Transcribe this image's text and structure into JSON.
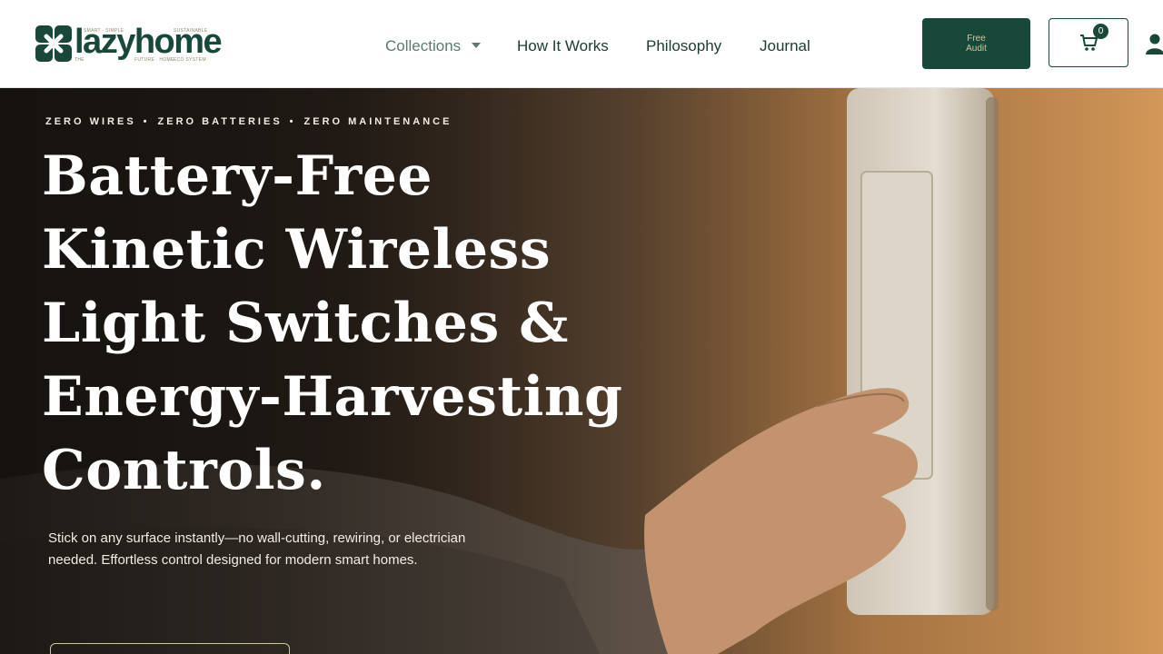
{
  "brand": {
    "name": "lazyhome",
    "tagline_top": "SMART · SIMPLE",
    "tagline_top_right": "SUSTAINABLE",
    "tagline_bottom_left": "THE",
    "tagline_bottom": "FUTURE · HOME",
    "tagline_bottom_right": "ECO SYSTEM"
  },
  "nav": {
    "items": [
      {
        "label": "Collections",
        "has_dropdown": true
      },
      {
        "label": "How It Works"
      },
      {
        "label": "Philosophy"
      },
      {
        "label": "Journal"
      }
    ]
  },
  "header_actions": {
    "audit_label": "Free Audit",
    "cart_count": "0",
    "cart_icon": "cart-icon",
    "user_icon": "user-icon"
  },
  "hero": {
    "eyebrow": [
      "ZERO WIRES",
      "ZERO BATTERIES",
      "ZERO MAINTENANCE"
    ],
    "eyebrow_separator": "•",
    "headline_lines": [
      "Battery-Free",
      "Kinetic Wireless",
      "Light Switches &",
      "Energy-Harvesting",
      "Controls."
    ],
    "subtext": "Stick on any surface instantly—no wall-cutting, rewiring, or electrician needed. Effortless control designed for modern smart homes."
  },
  "colors": {
    "brand_green": "#17483a",
    "accent_gold": "#d7c49a",
    "hero_text": "#ffffff"
  }
}
